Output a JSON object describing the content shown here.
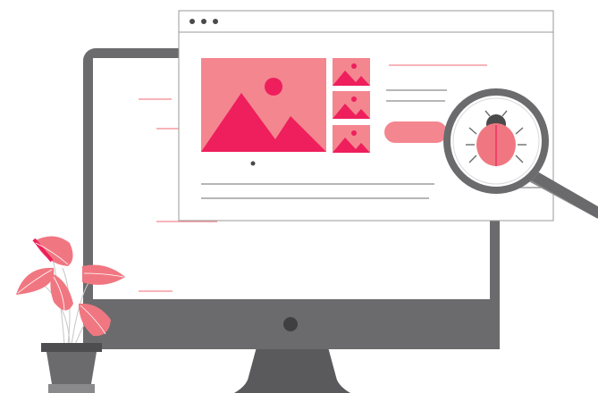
{
  "illustration": {
    "subject": "bug-inspection",
    "icons": [
      "monitor-icon",
      "browser-window-icon",
      "image-placeholder-icon",
      "magnifying-glass-icon",
      "bug-icon",
      "potted-plant-icon"
    ],
    "colors": {
      "monitor": "#6b6b6d",
      "monitor_dark": "#5a5a5c",
      "screen": "#ffffff",
      "accent_strong": "#ee1f5c",
      "accent_soft": "#f4868f",
      "bug_body": "#f07781",
      "line_gray": "#8a8a8a",
      "pot": "#4d4d4f"
    }
  }
}
